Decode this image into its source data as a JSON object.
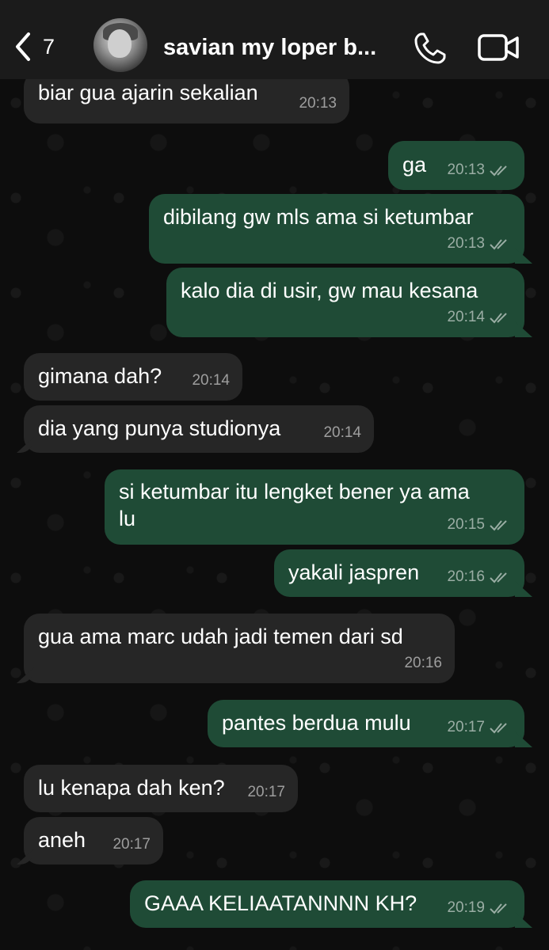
{
  "header": {
    "back_count": "7",
    "contact_name": "savian my loper b..."
  },
  "messages": [
    {
      "dir": "in",
      "text": "biar gua ajarin sekalian",
      "time": "20:13"
    },
    {
      "dir": "out",
      "text": "ga",
      "time": "20:13",
      "status": "read"
    },
    {
      "dir": "out",
      "text": "dibilang gw mls ama si ketumbar",
      "time": "20:13",
      "status": "read"
    },
    {
      "dir": "out",
      "text": "kalo dia di usir, gw mau kesana",
      "time": "20:14",
      "status": "read"
    },
    {
      "dir": "in",
      "text": "gimana dah?",
      "time": "20:14"
    },
    {
      "dir": "in",
      "text": "dia yang punya studionya",
      "time": "20:14"
    },
    {
      "dir": "out",
      "text_line1": "si ketumbar itu lengket bener ya ama",
      "text_line2": "lu",
      "time": "20:15",
      "status": "read"
    },
    {
      "dir": "out",
      "text": "yakali jaspren",
      "time": "20:16",
      "status": "read"
    },
    {
      "dir": "in",
      "text": "gua ama marc udah jadi temen dari sd",
      "time": "20:16"
    },
    {
      "dir": "out",
      "text": "pantes berdua mulu",
      "time": "20:17",
      "status": "read"
    },
    {
      "dir": "in",
      "text": "lu kenapa dah ken?",
      "time": "20:17"
    },
    {
      "dir": "in",
      "text": "aneh",
      "time": "20:17"
    },
    {
      "dir": "out",
      "text": "GAAA KELIAATANNNN KH?",
      "time": "20:19",
      "status": "read"
    }
  ],
  "colors": {
    "incoming_bubble": "#262626",
    "outgoing_bubble": "#1f4b36",
    "header_bg": "#1b1b1b",
    "chat_bg": "#0d0d0d"
  },
  "icons": {
    "back": "chevron-left-icon",
    "call": "phone-icon",
    "video": "video-camera-icon",
    "read_receipt": "double-check-icon"
  }
}
